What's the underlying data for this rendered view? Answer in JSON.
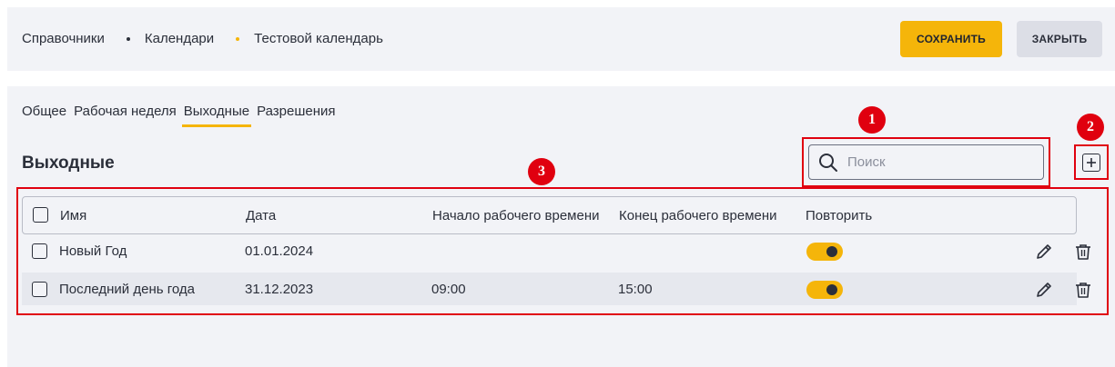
{
  "breadcrumb": {
    "items": [
      "Справочники",
      "Календари",
      "Тестовой календарь"
    ],
    "separator_colors": [
      "#2b2f3a",
      "#f5b50a"
    ]
  },
  "toolbar": {
    "save_label": "СОХРАНИТЬ",
    "close_label": "ЗАКРЫТЬ"
  },
  "tabs": [
    {
      "label": "Общее",
      "active": false
    },
    {
      "label": "Рабочая неделя",
      "active": false
    },
    {
      "label": "Выходные",
      "active": true
    },
    {
      "label": "Разрешения",
      "active": false
    }
  ],
  "section": {
    "title": "Выходные"
  },
  "search": {
    "placeholder": "Поиск",
    "value": ""
  },
  "table": {
    "columns": [
      "Имя",
      "Дата",
      "Начало рабочего времени",
      "Конец рабочего времени",
      "Повторить"
    ],
    "rows": [
      {
        "name": "Новый Год",
        "date": "01.01.2024",
        "start": "",
        "end": "",
        "repeat": true
      },
      {
        "name": "Последний день года",
        "date": "31.12.2023",
        "start": "09:00",
        "end": "15:00",
        "repeat": true
      }
    ]
  },
  "annotations": {
    "labels": [
      "1",
      "2",
      "3"
    ]
  },
  "colors": {
    "accent": "#f5b50a",
    "annotation": "#e0000f",
    "panel_background": "#f2f3f7"
  }
}
